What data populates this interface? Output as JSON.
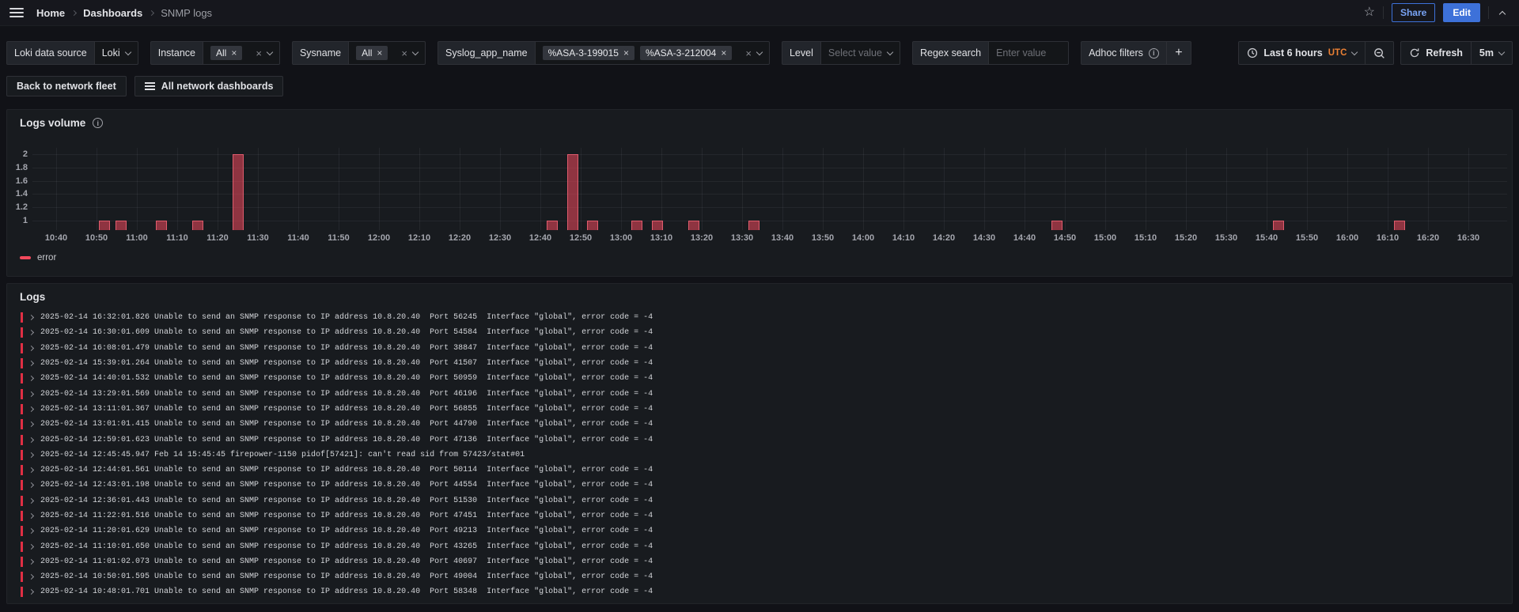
{
  "colors": {
    "accent_blue": "#3D71D9",
    "error_red": "#F2495C",
    "log_border_red": "#E02F44",
    "utc_orange": "#EB8034",
    "panel_bg": "#181b1f",
    "page_bg": "#111217"
  },
  "topnav": {
    "breadcrumbs": [
      "Home",
      "Dashboards",
      "SNMP logs"
    ],
    "share_label": "Share",
    "edit_label": "Edit"
  },
  "filters": [
    {
      "label": "Loki data source",
      "type": "select",
      "value": "Loki"
    },
    {
      "label": "Instance",
      "type": "multi",
      "chips": [
        "All"
      ]
    },
    {
      "label": "Sysname",
      "type": "multi",
      "chips": [
        "All"
      ]
    },
    {
      "label": "Syslog_app_name",
      "type": "multi",
      "chips": [
        "%ASA-3-199015",
        "%ASA-3-212004"
      ]
    },
    {
      "label": "Level",
      "type": "select-placeholder",
      "placeholder": "Select value"
    },
    {
      "label": "Regex search",
      "type": "input",
      "placeholder": "Enter value"
    },
    {
      "label": "Adhoc filters",
      "type": "adhoc",
      "info": true,
      "add_button": "+"
    }
  ],
  "toolbar": {
    "time_range": "Last 6 hours",
    "timezone": "UTC",
    "refresh_label": "Refresh",
    "refresh_interval": "5m"
  },
  "nav_buttons": [
    {
      "label": "Back to network fleet"
    },
    {
      "label": "All network dashboards",
      "icon": "list"
    }
  ],
  "logs_volume_panel": {
    "title": "Logs volume",
    "legend": "error"
  },
  "logs_panel": {
    "title": "Logs",
    "rows": [
      "2025-02-14 16:32:01.826 Unable to send an SNMP response to IP address 10.8.20.40  Port 56245  Interface \"global\", error code = -4",
      "2025-02-14 16:30:01.609 Unable to send an SNMP response to IP address 10.8.20.40  Port 54584  Interface \"global\", error code = -4",
      "2025-02-14 16:08:01.479 Unable to send an SNMP response to IP address 10.8.20.40  Port 38847  Interface \"global\", error code = -4",
      "2025-02-14 15:39:01.264 Unable to send an SNMP response to IP address 10.8.20.40  Port 41507  Interface \"global\", error code = -4",
      "2025-02-14 14:40:01.532 Unable to send an SNMP response to IP address 10.8.20.40  Port 50959  Interface \"global\", error code = -4",
      "2025-02-14 13:29:01.569 Unable to send an SNMP response to IP address 10.8.20.40  Port 46196  Interface \"global\", error code = -4",
      "2025-02-14 13:11:01.367 Unable to send an SNMP response to IP address 10.8.20.40  Port 56855  Interface \"global\", error code = -4",
      "2025-02-14 13:01:01.415 Unable to send an SNMP response to IP address 10.8.20.40  Port 44790  Interface \"global\", error code = -4",
      "2025-02-14 12:59:01.623 Unable to send an SNMP response to IP address 10.8.20.40  Port 47136  Interface \"global\", error code = -4",
      "2025-02-14 12:45:45.947 Feb 14 15:45:45 firepower-1150 pidof[57421]: can't read sid from 57423/stat#01",
      "2025-02-14 12:44:01.561 Unable to send an SNMP response to IP address 10.8.20.40  Port 50114  Interface \"global\", error code = -4",
      "2025-02-14 12:43:01.198 Unable to send an SNMP response to IP address 10.8.20.40  Port 44554  Interface \"global\", error code = -4",
      "2025-02-14 12:36:01.443 Unable to send an SNMP response to IP address 10.8.20.40  Port 51530  Interface \"global\", error code = -4",
      "2025-02-14 11:22:01.516 Unable to send an SNMP response to IP address 10.8.20.40  Port 47451  Interface \"global\", error code = -4",
      "2025-02-14 11:20:01.629 Unable to send an SNMP response to IP address 10.8.20.40  Port 49213  Interface \"global\", error code = -4",
      "2025-02-14 11:10:01.650 Unable to send an SNMP response to IP address 10.8.20.40  Port 43265  Interface \"global\", error code = -4",
      "2025-02-14 11:01:02.073 Unable to send an SNMP response to IP address 10.8.20.40  Port 40697  Interface \"global\", error code = -4",
      "2025-02-14 10:50:01.595 Unable to send an SNMP response to IP address 10.8.20.40  Port 49004  Interface \"global\", error code = -4",
      "2025-02-14 10:48:01.701 Unable to send an SNMP response to IP address 10.8.20.40  Port 58348  Interface \"global\", error code = -4"
    ]
  },
  "chart_data": {
    "type": "bar",
    "title": "Logs volume",
    "x_ticks": [
      "10:40",
      "10:50",
      "11:00",
      "11:10",
      "11:20",
      "11:30",
      "11:40",
      "11:50",
      "12:00",
      "12:10",
      "12:20",
      "12:30",
      "12:40",
      "12:50",
      "13:00",
      "13:10",
      "13:20",
      "13:30",
      "13:40",
      "13:50",
      "14:00",
      "14:10",
      "14:20",
      "14:30",
      "14:40",
      "14:50",
      "15:00",
      "15:10",
      "15:20",
      "15:30",
      "15:40",
      "15:50",
      "16:00",
      "16:10",
      "16:20",
      "16:30"
    ],
    "y_ticks": [
      "2",
      "1.8",
      "1.6",
      "1.4",
      "1.2",
      "1"
    ],
    "y_range": [
      0.86,
      2.1
    ],
    "grid": true,
    "legend_position": "bottom-left",
    "series": [
      {
        "name": "error",
        "color": "#F2495C",
        "points": [
          {
            "t": "10:52",
            "v": 1
          },
          {
            "t": "10:56",
            "v": 1
          },
          {
            "t": "11:06",
            "v": 1
          },
          {
            "t": "11:15",
            "v": 1
          },
          {
            "t": "11:25",
            "v": 2
          },
          {
            "t": "12:43",
            "v": 1
          },
          {
            "t": "12:48",
            "v": 2
          },
          {
            "t": "12:53",
            "v": 1
          },
          {
            "t": "13:04",
            "v": 1
          },
          {
            "t": "13:09",
            "v": 1
          },
          {
            "t": "13:18",
            "v": 1
          },
          {
            "t": "13:33",
            "v": 1
          },
          {
            "t": "14:48",
            "v": 1
          },
          {
            "t": "15:43",
            "v": 1
          },
          {
            "t": "16:13",
            "v": 1
          }
        ]
      }
    ]
  }
}
